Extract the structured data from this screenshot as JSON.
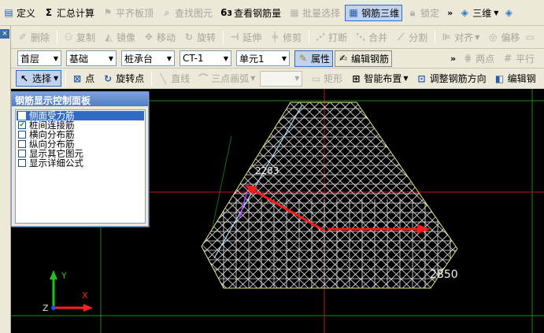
{
  "toolbar1": {
    "define": "定义",
    "sum_calc": "汇总计算",
    "flush_slab_top": "平齐板顶",
    "find_element": "查找图元",
    "view_rebar_qty": "查看钢筋量",
    "batch_select": "批量选择",
    "rebar_3d": "钢筋三维",
    "lock": "锁定",
    "view_3d": "三维"
  },
  "toolbar2": {
    "delete": "删除",
    "copy": "复制",
    "mirror": "镜像",
    "move": "移动",
    "rotate": "旋转",
    "extend": "延伸",
    "trim": "修剪",
    "break": "打断",
    "merge": "合并",
    "split": "分割",
    "align": "对齐",
    "offset": "偏移"
  },
  "toolbar3": {
    "floor": "首层",
    "category": "基础",
    "element_type": "桩承台",
    "element_name": "CT-1",
    "unit": "单元1",
    "properties": "属性",
    "edit_rebar": "编辑钢筋",
    "two_points": "两点",
    "parallel": "平行"
  },
  "toolbar4": {
    "select": "选择",
    "point": "点",
    "rotate_point": "旋转点",
    "line": "直线",
    "three_point_arc": "三点画弧",
    "rectangle": "矩形",
    "smart_layout": "智能布置",
    "adjust_rebar_dir": "调整钢筋方向",
    "edit_rebar_cut": "编辑钢"
  },
  "panel": {
    "title": "钢筋显示控制面板",
    "items": [
      {
        "label": "侧面受力筋",
        "checked": false
      },
      {
        "label": "桩间连接筋",
        "checked": true
      },
      {
        "label": "横向分布筋",
        "checked": false
      },
      {
        "label": "纵向分布筋",
        "checked": false
      },
      {
        "label": "显示其它图元",
        "checked": false
      },
      {
        "label": "显示详细公式",
        "checked": false
      }
    ]
  },
  "canvas": {
    "dim_left": "2283",
    "dim_bottom": "2850",
    "axis_x": "X",
    "axis_y": "Y",
    "axis_z": "Z"
  },
  "colors": {
    "toolbar_bg": "#ece9d8",
    "active_blue": "#316ac5",
    "mesh_white": "#ffffff",
    "outline_yellow": "#e8e87a",
    "axis_red": "#ff2020",
    "axis_green": "#20c020",
    "arrow_red": "#ff1a1a"
  }
}
